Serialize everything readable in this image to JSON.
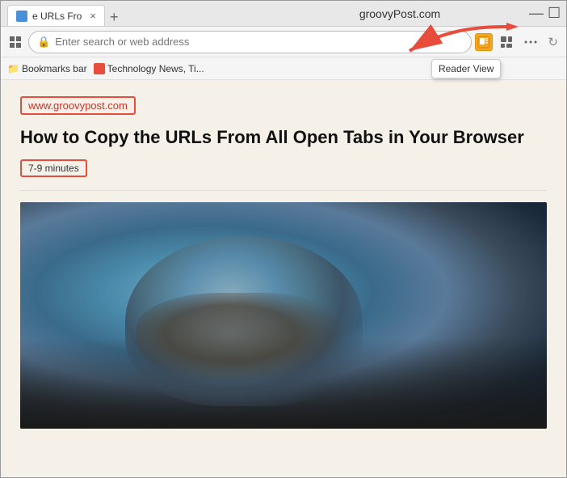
{
  "titleBar": {
    "tab": {
      "title": "e URLs Fro",
      "closeLabel": "×"
    },
    "newTabLabel": "+",
    "centerTitle": "groovyPost.com",
    "windowControls": {
      "minimize": "—",
      "maximize": "☐"
    }
  },
  "toolbar": {
    "addressBar": {
      "placeholder": "Enter search or web address"
    },
    "readerViewLabel": "Reader View"
  },
  "bookmarksBar": {
    "label": "Bookmarks bar",
    "items": [
      {
        "label": "Technology News, Ti..."
      }
    ]
  },
  "pageContent": {
    "siteUrl": "www.groovypost.com",
    "articleTitle": "How to Copy the URLs From All Open Tabs in Your Browser",
    "readingTime": "7-9 minutes"
  }
}
